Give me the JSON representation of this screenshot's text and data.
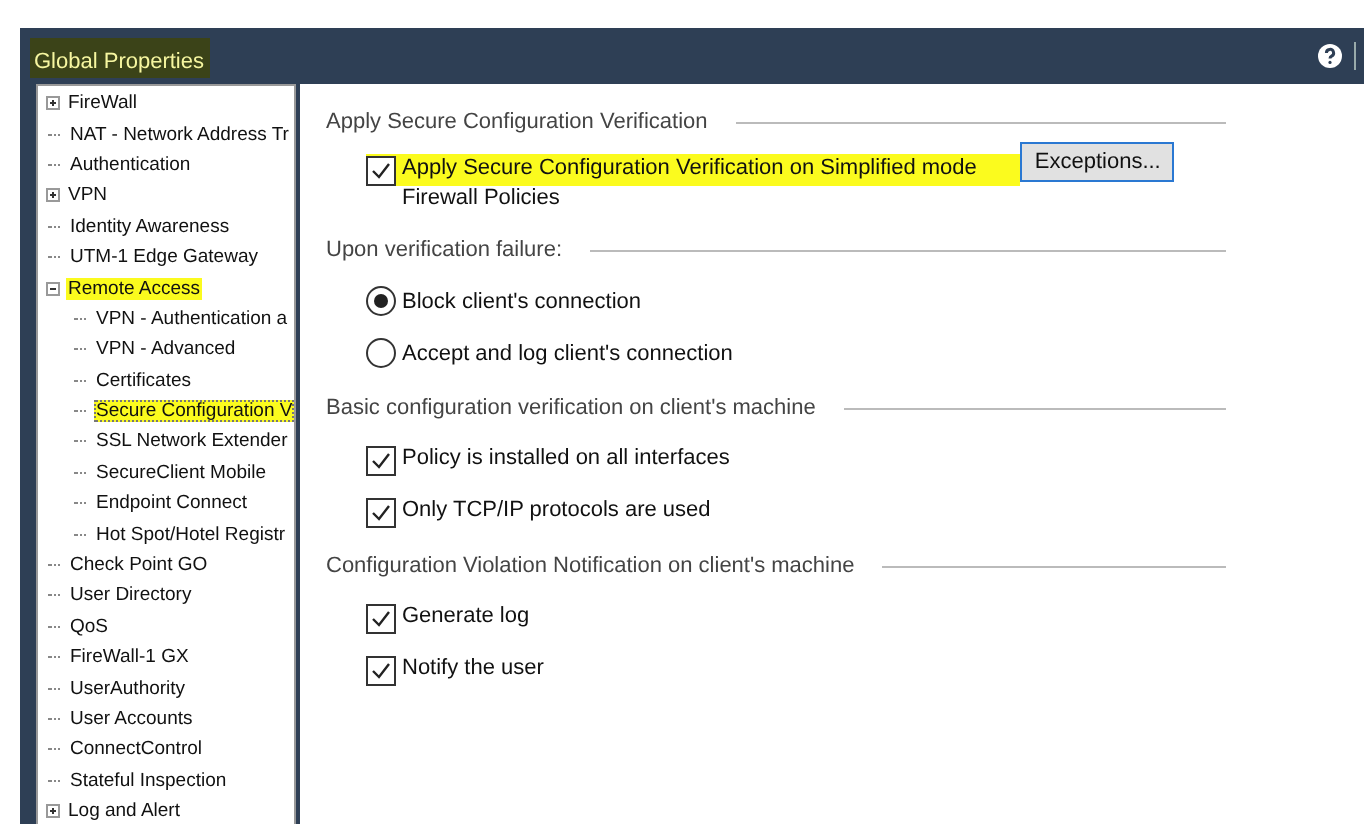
{
  "window": {
    "title": "Global Properties",
    "title_highlighted": true
  },
  "tree": [
    {
      "label": "FireWall",
      "expandable": true,
      "expanded": false,
      "selected": false,
      "highlighted": false
    },
    {
      "label": "NAT - Network Address Tr",
      "selected": false,
      "highlighted": false
    },
    {
      "label": "Authentication",
      "selected": false,
      "highlighted": false
    },
    {
      "label": "VPN",
      "expandable": true,
      "expanded": false,
      "selected": false,
      "highlighted": false
    },
    {
      "label": "Identity Awareness",
      "selected": false,
      "highlighted": false
    },
    {
      "label": "UTM-1 Edge Gateway",
      "selected": false,
      "highlighted": false
    },
    {
      "label": "Remote Access",
      "expandable": true,
      "expanded": true,
      "selected": false,
      "highlighted": true,
      "children": [
        {
          "label": "VPN - Authentication a",
          "selected": false,
          "highlighted": false
        },
        {
          "label": "VPN - Advanced",
          "selected": false,
          "highlighted": false
        },
        {
          "label": "Certificates",
          "selected": false,
          "highlighted": false
        },
        {
          "label": "Secure Configuration V",
          "selected": true,
          "highlighted": true
        },
        {
          "label": "SSL Network Extender",
          "selected": false,
          "highlighted": false
        },
        {
          "label": "SecureClient Mobile",
          "selected": false,
          "highlighted": false
        },
        {
          "label": "Endpoint Connect",
          "selected": false,
          "highlighted": false
        },
        {
          "label": "Hot Spot/Hotel Registr",
          "selected": false,
          "highlighted": false
        }
      ]
    },
    {
      "label": "Check Point GO",
      "selected": false,
      "highlighted": false
    },
    {
      "label": "User Directory",
      "selected": false,
      "highlighted": false
    },
    {
      "label": "QoS",
      "selected": false,
      "highlighted": false
    },
    {
      "label": "FireWall-1 GX",
      "selected": false,
      "highlighted": false
    },
    {
      "label": "UserAuthority",
      "selected": false,
      "highlighted": false
    },
    {
      "label": "User Accounts",
      "selected": false,
      "highlighted": false
    },
    {
      "label": "ConnectControl",
      "selected": false,
      "highlighted": false
    },
    {
      "label": "Stateful Inspection",
      "selected": false,
      "highlighted": false
    },
    {
      "label": "Log and Alert",
      "expandable": true,
      "expanded": false,
      "selected": false,
      "highlighted": false
    }
  ],
  "sections": [
    {
      "title": "Apply Secure Configuration Verification",
      "options": [
        {
          "kind": "checkbox",
          "label": "Apply Secure Configuration Verification on Simplified mode",
          "label_line_2": "Firewall Policies",
          "checked": true,
          "highlighted": true,
          "button": "Exceptions..."
        }
      ]
    },
    {
      "title": "Upon verification failure:",
      "options": [
        {
          "kind": "radio",
          "label": "Block client's connection",
          "selected": true
        },
        {
          "kind": "radio",
          "label": "Accept and log client's connection",
          "selected": false
        }
      ]
    },
    {
      "title": "Basic configuration verification on client's machine",
      "options": [
        {
          "kind": "checkbox",
          "label": "Policy is installed on all interfaces",
          "checked": true
        },
        {
          "kind": "checkbox",
          "label": "Only TCP/IP protocols are used",
          "checked": true
        }
      ]
    },
    {
      "title": "Configuration Violation Notification on client's machine",
      "options": [
        {
          "kind": "checkbox",
          "label": "Generate log",
          "checked": true
        },
        {
          "kind": "checkbox",
          "label": "Notify the user",
          "checked": true
        }
      ]
    }
  ]
}
